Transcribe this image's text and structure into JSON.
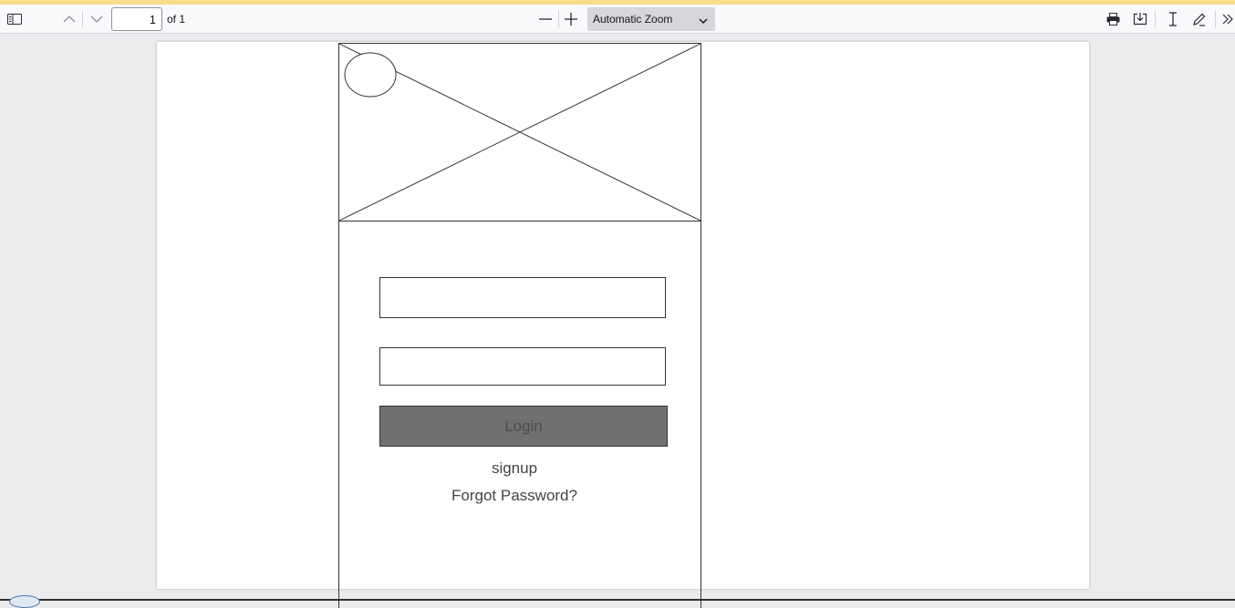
{
  "toolbar": {
    "page_number": "1",
    "page_count_label": "of 1",
    "zoom_label": "Automatic Zoom"
  },
  "icons": {
    "sidebar": "sidebar-toggle-icon",
    "prev": "chevron-up-icon",
    "next": "chevron-down-icon",
    "zoom_out": "minus-icon",
    "zoom_in": "plus-icon",
    "zoom_dropdown": "chevron-down-icon",
    "print": "printer-icon",
    "save": "download-icon",
    "text_select": "text-cursor-icon",
    "draw": "pencil-icon",
    "more": "double-chevron-right-icon"
  },
  "wireframe": {
    "login_label": "Login",
    "signup_label": "signup",
    "forgot_label": "Forgot Password?"
  },
  "colors": {
    "accent_strip": "#f8dd8a",
    "login_fill": "#707070"
  }
}
